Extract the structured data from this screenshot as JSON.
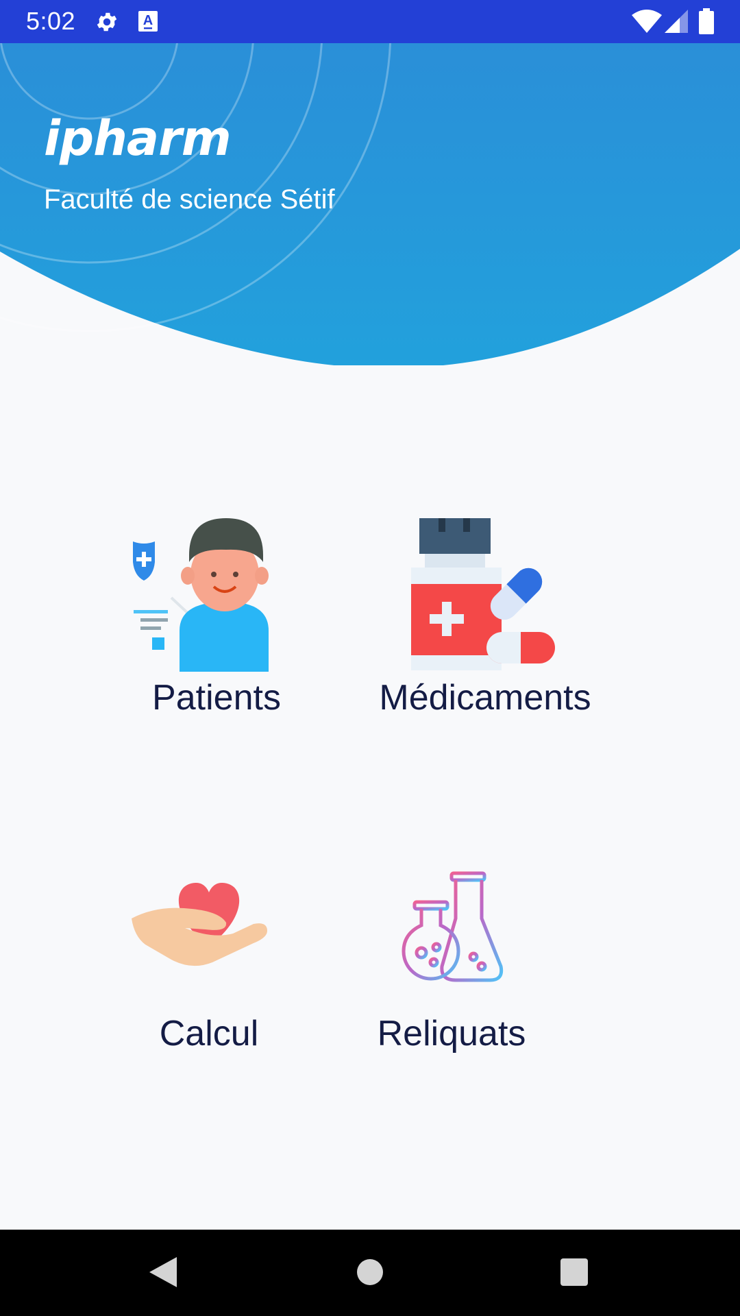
{
  "status_bar": {
    "time": "5:02",
    "icons": [
      "gear-icon",
      "keyboard-a-icon",
      "wifi-icon",
      "signal-icon",
      "battery-icon"
    ]
  },
  "header": {
    "brand": "ipharm",
    "subtitle": "Faculté de science Sétif",
    "color": "#2495d6"
  },
  "menu": {
    "patients": {
      "label": "Patients",
      "icon": "patient-icon"
    },
    "medicaments": {
      "label": "Médicaments",
      "icon": "medicine-bottle-icon"
    },
    "calcul": {
      "label": "Calcul",
      "icon": "hand-heart-icon"
    },
    "reliquats": {
      "label": "Reliquats",
      "icon": "lab-flasks-icon"
    }
  },
  "nav_bar": {
    "buttons": [
      "back-icon",
      "home-icon",
      "recents-icon"
    ]
  },
  "colors": {
    "status_bar": "#2340d6",
    "label_text": "#141c45",
    "background": "#f8f9fb"
  }
}
